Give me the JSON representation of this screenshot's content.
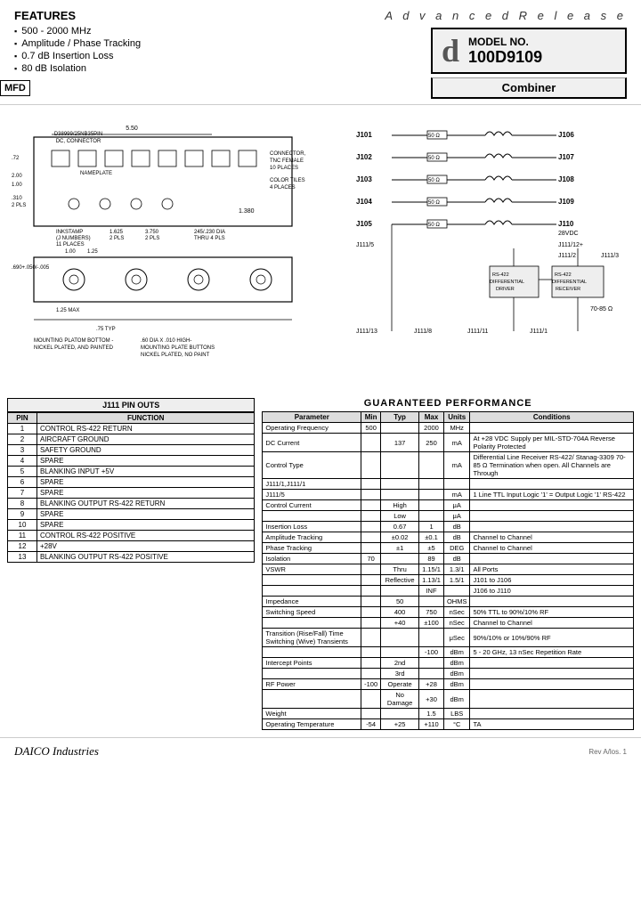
{
  "header": {
    "advanced_release": "A d v a n c e d   R e l e a s e",
    "model_no_label": "MODEL NO.",
    "model_no_value": "100D9109",
    "combiner_label": "Combiner",
    "features_title": "FEATURES",
    "features": [
      "500 - 2000 MHz",
      "Amplitude / Phase Tracking",
      "0.7 dB Insertion Loss",
      "80 dB Isolation"
    ],
    "mfd": "MFD"
  },
  "pin_table": {
    "title": "J111 PIN OUTS",
    "col_pin": "PIN",
    "col_function": "FUNCTION",
    "rows": [
      {
        "pin": "1",
        "function": "CONTROL RS-422 RETURN"
      },
      {
        "pin": "2",
        "function": "AIRCRAFT GROUND"
      },
      {
        "pin": "3",
        "function": "SAFETY GROUND"
      },
      {
        "pin": "4",
        "function": "SPARE"
      },
      {
        "pin": "5",
        "function": "BLANKING INPUT +5V"
      },
      {
        "pin": "6",
        "function": "SPARE"
      },
      {
        "pin": "7",
        "function": "SPARE"
      },
      {
        "pin": "8",
        "function": "BLANKING OUTPUT RS-422 RETURN"
      },
      {
        "pin": "9",
        "function": "SPARE"
      },
      {
        "pin": "10",
        "function": "SPARE"
      },
      {
        "pin": "11",
        "function": "CONTROL RS-422 POSITIVE"
      },
      {
        "pin": "12",
        "function": "+28V"
      },
      {
        "pin": "13",
        "function": "BLANKING OUTPUT RS-422 POSITIVE"
      }
    ]
  },
  "performance_table": {
    "title": "GUARANTEED PERFORMANCE",
    "columns": [
      "Parameter",
      "Min",
      "Typ",
      "Max",
      "Units",
      "Conditions"
    ],
    "rows": [
      {
        "param": "Operating Frequency",
        "min": "500",
        "typ": "",
        "max": "2000",
        "units": "MHz",
        "cond": ""
      },
      {
        "param": "DC Current",
        "min": "",
        "typ": "137",
        "max": "250",
        "units": "mA",
        "cond": "At +28 VDC Supply per MIL-STD-704A Reverse Polarity Protected"
      },
      {
        "param": "Control Type",
        "min": "",
        "typ": "",
        "max": "",
        "units": "mA",
        "cond": "Differential Line Receiver RS-422/ Stanag-3309 70-85 Ω Termination when open. All Channels are Through"
      },
      {
        "param": "J111/1,J111/1",
        "min": "",
        "typ": "",
        "max": "",
        "units": "",
        "cond": ""
      },
      {
        "param": "J111/5",
        "min": "",
        "typ": "",
        "max": "",
        "units": "mA",
        "cond": "1 Line TTL Input Logic '1' = Output Logic '1' RS-422"
      },
      {
        "param": "Control Current",
        "min": "",
        "typ": "High",
        "max": "",
        "units": "μA",
        "cond": ""
      },
      {
        "param": "",
        "min": "",
        "typ": "Low",
        "max": "",
        "units": "μA",
        "cond": ""
      },
      {
        "param": "Insertion Loss",
        "min": "",
        "typ": "0.67",
        "max": "1",
        "units": "dB",
        "cond": ""
      },
      {
        "param": "Amplitude Tracking",
        "min": "",
        "typ": "±0.02",
        "max": "±0.1",
        "units": "dB",
        "cond": "Channel to Channel"
      },
      {
        "param": "Phase Tracking",
        "min": "",
        "typ": "±1",
        "max": "±5",
        "units": "DEG",
        "cond": "Channel to Channel"
      },
      {
        "param": "Isolation",
        "min": "70",
        "typ": "",
        "max": "89",
        "units": "dB",
        "cond": ""
      },
      {
        "param": "VSWR",
        "min": "",
        "typ": "Thru",
        "max": "1.15/1",
        "units": "1.3/1",
        "cond": "All Ports"
      },
      {
        "param": "",
        "min": "",
        "typ": "Reflective",
        "max": "1.13/1",
        "units": "1.5/1",
        "cond": "J101 to J106"
      },
      {
        "param": "",
        "min": "",
        "typ": "",
        "max": "INF",
        "units": "",
        "cond": "J106 to J110"
      },
      {
        "param": "Impedance",
        "min": "",
        "typ": "50",
        "max": "",
        "units": "OHMS",
        "cond": ""
      },
      {
        "param": "Switching Speed",
        "min": "",
        "typ": "400",
        "max": "750",
        "units": "nSec",
        "cond": "50% TTL to 90%/10% RF"
      },
      {
        "param": "",
        "min": "",
        "typ": "+40",
        "max": "±100",
        "units": "nSec",
        "cond": "Channel to Channel"
      },
      {
        "param": "Transition (Rise/Fall) Time Switching (Wive) Transients",
        "min": "",
        "typ": "",
        "max": "",
        "units": "μSec",
        "cond": "90%/10% or 10%/90% RF"
      },
      {
        "param": "",
        "min": "",
        "typ": "",
        "max": "-100",
        "units": "dBm",
        "cond": "5 - 20 GHz, 13 nSec Repetition Rate"
      },
      {
        "param": "Intercept Points",
        "min": "",
        "typ": "2nd",
        "max": "",
        "units": "dBm",
        "cond": ""
      },
      {
        "param": "",
        "min": "",
        "typ": "3rd",
        "max": "",
        "units": "dBm",
        "cond": ""
      },
      {
        "param": "RF Power",
        "min": "-100",
        "typ": "Operate",
        "max": "+28",
        "units": "dBm",
        "cond": ""
      },
      {
        "param": "",
        "min": "",
        "typ": "No Damage",
        "max": "+30",
        "units": "dBm",
        "cond": ""
      },
      {
        "param": "Weight",
        "min": "",
        "typ": "",
        "max": "1.5",
        "units": "LBS",
        "cond": ""
      },
      {
        "param": "Operating Temperature",
        "min": "-54",
        "typ": "+25",
        "max": "+110",
        "units": "°C",
        "cond": "TA"
      }
    ]
  },
  "footer": {
    "company": "DAICO",
    "company_sub": "Industries",
    "rev": "Rev A/los. 1"
  },
  "connectors": {
    "labels": [
      "J101",
      "J102",
      "J103",
      "J104",
      "J105",
      "J106",
      "J107",
      "J108",
      "J109",
      "J110",
      "J111/12+",
      "J111/5",
      "J111/2",
      "J111/3",
      "J111/13",
      "J111/8",
      "J111/11",
      "J111/1"
    ],
    "resistor_label": "50 Ω",
    "voltage_label": "28VDC",
    "rs422_driver": "RS-422\nDIFFERENTIAL\nDRIVER",
    "rs422_receiver": "RS-422\nDIFFERENTIAL\nRECEIVER",
    "termination": "70-85 Ω"
  }
}
